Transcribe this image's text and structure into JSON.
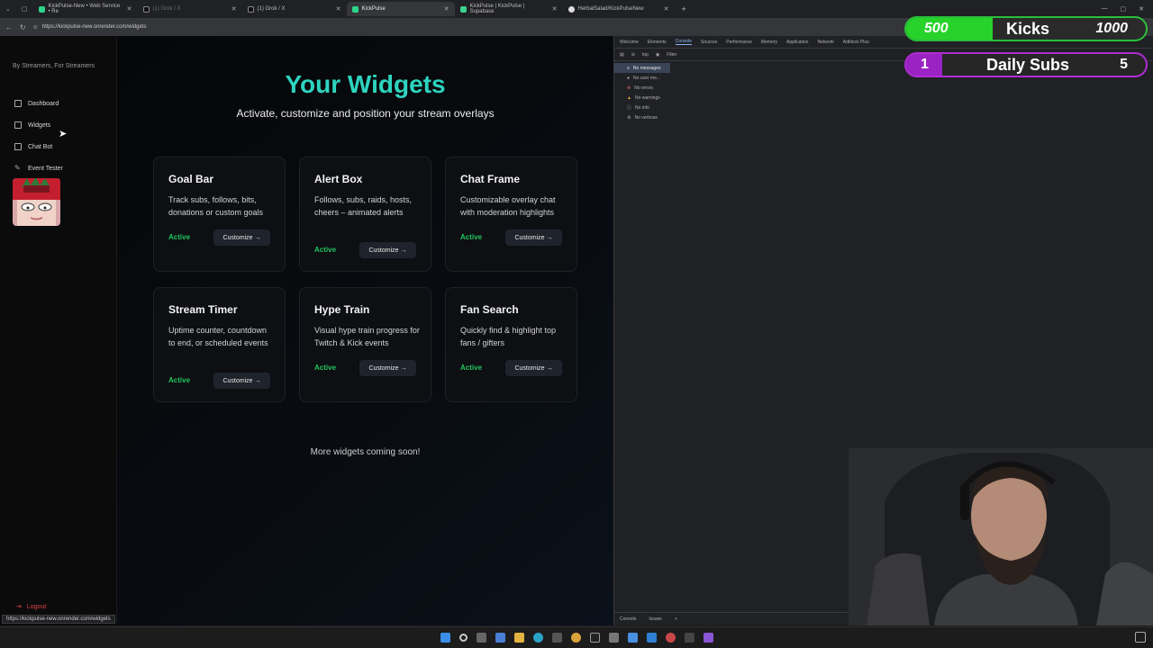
{
  "browser": {
    "tabs": [
      {
        "title": "KickPulse-New • Web Service • Re",
        "icon": "kickpulse-favicon",
        "active": false
      },
      {
        "title": "(1) Grok / X",
        "icon": "x-favicon",
        "active": false
      },
      {
        "title": "(1) Grok / X",
        "icon": "x-favicon",
        "active": false
      },
      {
        "title": "KickPulse",
        "icon": "kickpulse-favicon",
        "active": true
      },
      {
        "title": "KickPulse | KickPulse | Supabase",
        "icon": "supabase-favicon",
        "active": false
      },
      {
        "title": "HerbalSalad/KickPulseNew",
        "icon": "github-favicon",
        "active": false
      }
    ],
    "new_tab": "+",
    "url": "https://kickpulse-new.onrender.com/widgets",
    "status_url": "https://kickpulse-new.onrender.com/widgets"
  },
  "sidebar": {
    "tagline": "By Streamers, For Streamers",
    "items": [
      {
        "label": "Dashboard",
        "icon": "dashboard-icon"
      },
      {
        "label": "Widgets",
        "icon": "widgets-icon"
      },
      {
        "label": "Chat Bot",
        "icon": "chat-icon"
      },
      {
        "label": "Event Tester",
        "icon": "pencil-icon"
      }
    ],
    "logout": "Logout"
  },
  "main": {
    "title": "Your Widgets",
    "subtitle": "Activate, customize and position your stream overlays",
    "cards": [
      {
        "title": "Goal Bar",
        "desc": "Track subs, follows, bits, donations or custom goals",
        "status": "Active",
        "button": "Customize →"
      },
      {
        "title": "Alert Box",
        "desc": "Follows, subs, raids, hosts, cheers – animated alerts",
        "status": "Active",
        "button": "Customize →"
      },
      {
        "title": "Chat Frame",
        "desc": "Customizable overlay chat with moderation highlights",
        "status": "Active",
        "button": "Customize →"
      },
      {
        "title": "Stream Timer",
        "desc": "Uptime counter, countdown to end, or scheduled events",
        "status": "Active",
        "button": "Customize →"
      },
      {
        "title": "Hype Train",
        "desc": "Visual hype train progress for Twitch & Kick events",
        "status": "Active",
        "button": "Customize →"
      },
      {
        "title": "Fan Search",
        "desc": "Quickly find & highlight top fans / gifters",
        "status": "Active",
        "button": "Customize →"
      }
    ],
    "more": "More widgets coming soon!"
  },
  "devtools": {
    "tabs": [
      "Welcome",
      "Elements",
      "Console",
      "Sources",
      "Performance",
      "Memory",
      "Application",
      "Network",
      "Adblock Plus"
    ],
    "active_tab": "Console",
    "context": "top",
    "filter_placeholder": "Filter",
    "filters": [
      "No messages",
      "No user me...",
      "No errors",
      "No warnings",
      "No info",
      "No verbose"
    ],
    "bottom_tabs": [
      "Console",
      "Issues"
    ]
  },
  "overlays": {
    "kicks_goal": {
      "current": "500",
      "label": "Kicks",
      "target": "1000",
      "color": "#27d32a"
    },
    "subs_goal": {
      "current": "1",
      "label": "Daily Subs",
      "target": "5",
      "color": "#9b23c4"
    }
  },
  "colors": {
    "accent": "#2dd4bf",
    "active_status": "#22c55e",
    "logout": "#e04545"
  }
}
